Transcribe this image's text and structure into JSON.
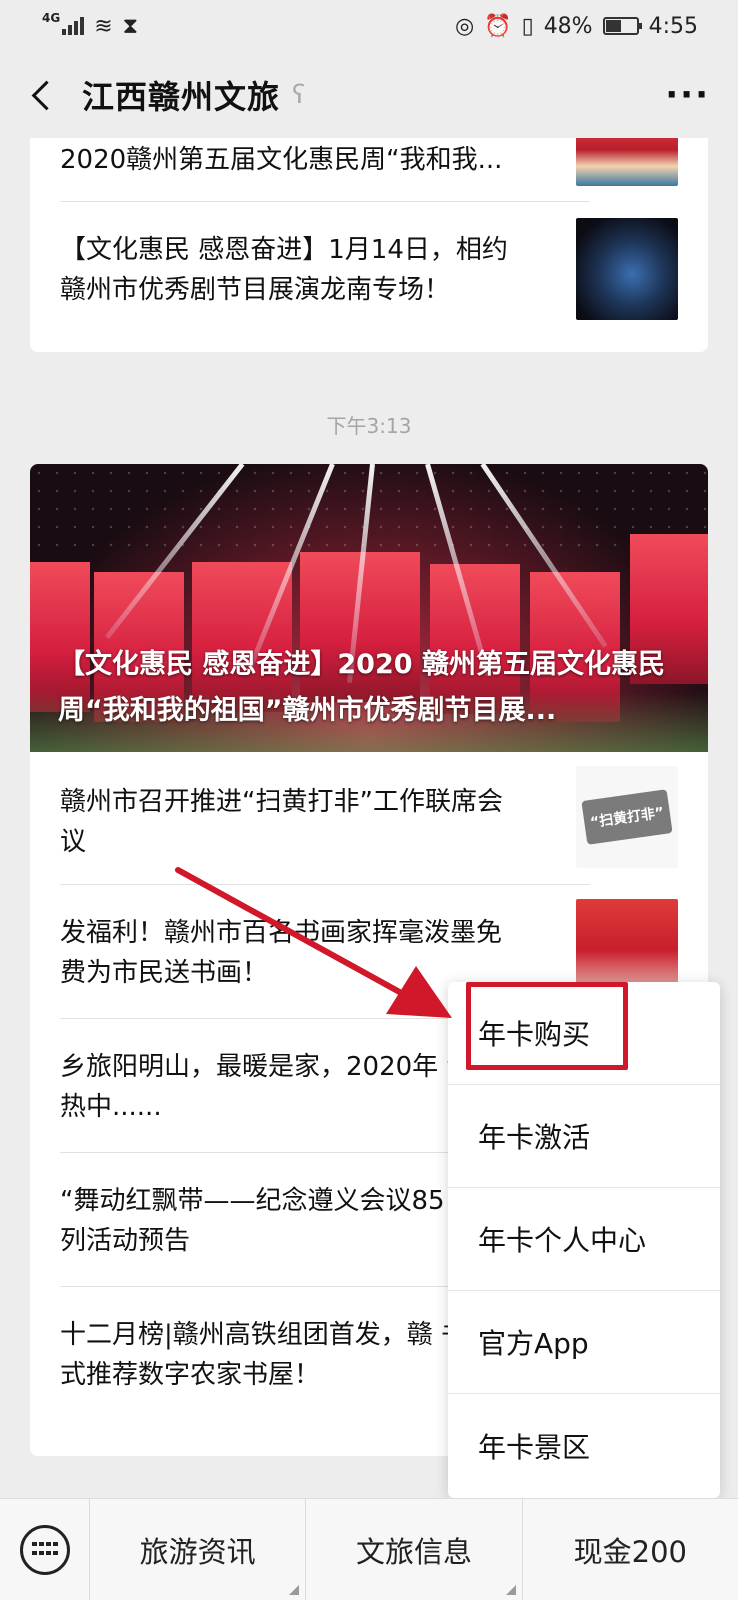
{
  "status_bar": {
    "network": "4G",
    "battery": "48%",
    "time": "4:55",
    "battery_level": 0.48
  },
  "nav": {
    "title": "江西赣州文旅"
  },
  "feed_top": {
    "articles": [
      {
        "title": "2020赣州第五届文化惠民周“我和我..."
      },
      {
        "title": "【文化惠民 感恩奋进】1月14日，相约赣州市优秀剧节目展演龙南专场！"
      }
    ]
  },
  "timestamp": "下午3:13",
  "feed_main": {
    "hero_title": "【文化惠民 感恩奋进】2020 赣州第五届文化惠民周“我和我的祖国”赣州市优秀剧节目展...",
    "articles": [
      {
        "title": "赣州市召开推进“扫黄打非”工作联席会议",
        "thumb_text": "“扫黄打非”"
      },
      {
        "title": "发福利！赣州市百名书画家挥毫泼墨免费为市民送书画！"
      },
      {
        "title": "乡旅阳明山，最暖是家，2020年 动预热中......"
      },
      {
        "title": "“舞动红飘带——纪念遵义会议85 年”系列活动预告"
      },
      {
        "title": "十二月榜|赣州高铁组团首发，赣 书馆花式推荐数字农家书屋！"
      }
    ]
  },
  "popup_menu": {
    "items": [
      {
        "label": "年卡购买"
      },
      {
        "label": "年卡激活"
      },
      {
        "label": "年卡个人中心"
      },
      {
        "label": "官方App"
      },
      {
        "label": "年卡景区"
      }
    ]
  },
  "bottom_bar": {
    "menus": [
      {
        "label": "旅游资讯"
      },
      {
        "label": "文旅信息"
      },
      {
        "label": "现金200"
      }
    ]
  },
  "colors": {
    "annotation_red": "#d0182a",
    "background": "#ededed"
  }
}
